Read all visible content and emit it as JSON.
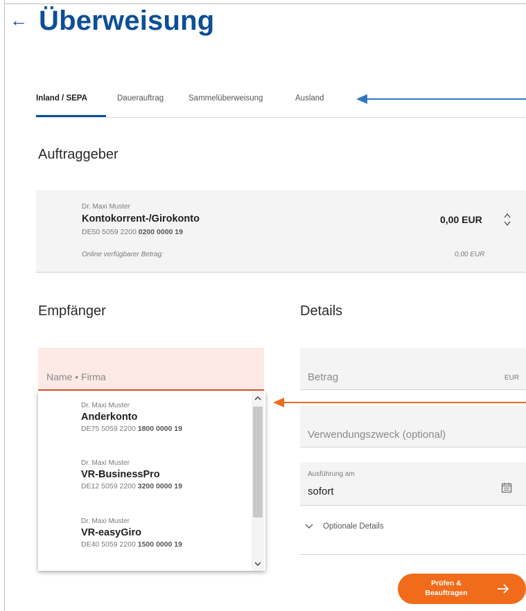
{
  "page": {
    "title": "Überweisung",
    "back_icon": "arrow-left-icon"
  },
  "tabs": [
    {
      "label": "Inland / SEPA",
      "active": true
    },
    {
      "label": "Dauerauftrag",
      "active": false
    },
    {
      "label": "Sammelüberweisung",
      "active": false
    },
    {
      "label": "Ausland",
      "active": false
    }
  ],
  "payer": {
    "section_title": "Auftraggeber",
    "holder": "Dr. Maxi Muster",
    "account_name": "Kontokorrent-/Girokonto",
    "iban_prefix": "DE50 5059 2200 ",
    "iban_bold": "0200 0000 19",
    "balance": "0,00 EUR",
    "available_label": "Online verfügbarer Betrag:",
    "available_value": "0,00 EUR"
  },
  "recipient": {
    "section_title": "Empfänger",
    "name_placeholder": "Name • Firma",
    "suggestions": [
      {
        "holder": "Dr. Maxi Muster",
        "account_name": "Anderkonto",
        "iban_prefix": "DE75 5059 2200 ",
        "iban_bold": "1800 0000 19"
      },
      {
        "holder": "Dr. Maxi Muster",
        "account_name": "VR-BusinessPro",
        "iban_prefix": "DE12 5059 2200 ",
        "iban_bold": "3200 0000 19"
      },
      {
        "holder": "Dr. Maxi Muster",
        "account_name": "VR-easyGiro",
        "iban_prefix": "DE40 5059 2200 ",
        "iban_bold": "1500 0000 19"
      }
    ]
  },
  "details": {
    "section_title": "Details",
    "amount_placeholder": "Betrag",
    "amount_currency": "EUR",
    "purpose_placeholder": "Verwendungszweck (optional)",
    "execution_label": "Ausführung am",
    "execution_value": "sofort",
    "optional_label": "Optionale Details"
  },
  "actions": {
    "submit_label": "Prüfen & Beauftragen"
  },
  "colors": {
    "brand_blue": "#0c4f97",
    "accent_orange": "#f06c1a",
    "error_bg": "#fde9e6",
    "annotation_blue": "#2f76c0",
    "annotation_orange": "#ee6b1c"
  }
}
